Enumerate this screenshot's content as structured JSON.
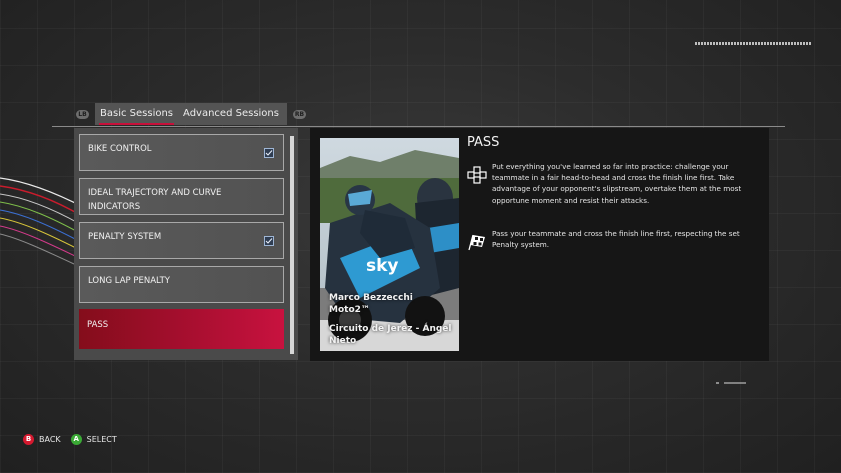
{
  "tabs": {
    "left_bumper": "LB",
    "right_bumper": "RB",
    "items": [
      {
        "label": "Basic Sessions",
        "active": true
      },
      {
        "label": "Advanced Sessions",
        "active": false
      }
    ]
  },
  "sessions": [
    {
      "label": "BIKE CONTROL",
      "checked": true,
      "selected": false
    },
    {
      "label": "IDEAL TRAJECTORY AND CURVE INDICATORS",
      "checked": false,
      "selected": false
    },
    {
      "label": "PENALTY SYSTEM",
      "checked": true,
      "selected": false
    },
    {
      "label": "LONG LAP PENALTY",
      "checked": false,
      "selected": false
    },
    {
      "label": "PASS",
      "checked": false,
      "selected": true
    }
  ],
  "detail": {
    "title": "PASS",
    "photo": {
      "rider": "Marco Bezzecchi",
      "class": "Moto2™",
      "circuit": "Circuito de Jerez - Ángel Nieto",
      "sponsor_text": "sky"
    },
    "objectives": [
      {
        "icon": "gamepad-icon",
        "text": "Put everything you've learned so far into practice: challenge your teammate in a fair head-to-head and cross the finish line first. Take advantage of your opponent's slipstream, overtake them at the most opportune moment and resist their attacks."
      },
      {
        "icon": "checkered-flag-icon",
        "text": "Pass your teammate and cross the finish line first, respecting the set Penalty system."
      }
    ]
  },
  "footer": {
    "back": {
      "button": "B",
      "label": "BACK",
      "color": "#d5192f"
    },
    "select": {
      "button": "A",
      "label": "SELECT",
      "color": "#3aa935"
    }
  },
  "colors": {
    "accent": "#c8103a",
    "selected_gradient_start": "#840d1b",
    "selected_gradient_end": "#c8123f",
    "checkbox_fill": "#2f3d52"
  }
}
